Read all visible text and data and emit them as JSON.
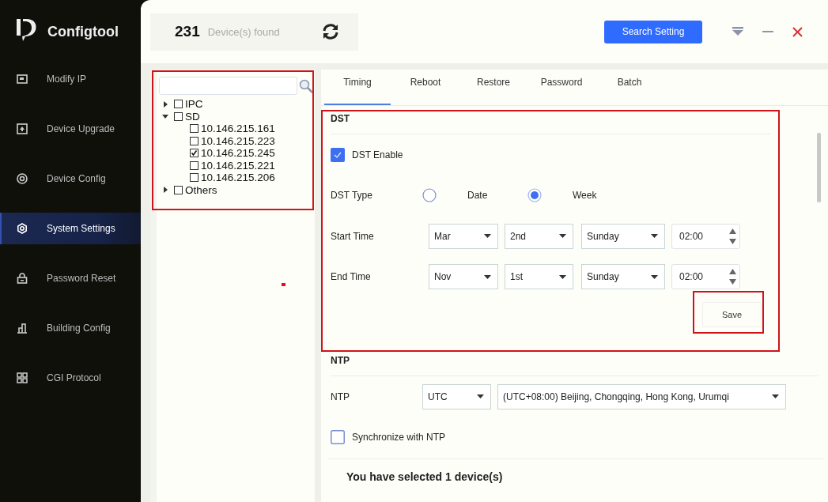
{
  "app": {
    "name": "Configtool"
  },
  "sidebar": {
    "items": [
      {
        "label": "Modify IP",
        "kind": "ip",
        "selected": false
      },
      {
        "label": "Device Upgrade",
        "kind": "upgrade",
        "selected": false
      },
      {
        "label": "Device Config",
        "kind": "config",
        "selected": false
      },
      {
        "label": "System Settings",
        "kind": "settings",
        "selected": true
      },
      {
        "label": "Password Reset",
        "kind": "lock",
        "selected": false
      },
      {
        "label": "Building Config",
        "kind": "building",
        "selected": false
      },
      {
        "label": "CGI Protocol",
        "kind": "grid",
        "selected": false
      }
    ]
  },
  "header": {
    "count": "231",
    "count_label": "Device(s) found",
    "search_button": "Search Setting"
  },
  "device_tree": {
    "highlighted": true,
    "items": [
      {
        "label": "IPC",
        "checked": false,
        "expanded": false
      },
      {
        "label": "SD",
        "checked": false,
        "expanded": true,
        "children": [
          {
            "label": "10.146.215.161",
            "checked": false
          },
          {
            "label": "10.146.215.223",
            "checked": false
          },
          {
            "label": "10.146.215.245",
            "checked": true
          },
          {
            "label": "10.146.215.221",
            "checked": false
          },
          {
            "label": "10.146.215.206",
            "checked": false
          }
        ]
      },
      {
        "label": "Others",
        "checked": false,
        "expanded": false
      }
    ]
  },
  "tabs": [
    {
      "label": "Timing",
      "selected": true
    },
    {
      "label": "Reboot",
      "selected": false
    },
    {
      "label": "Restore",
      "selected": false
    },
    {
      "label": "Password",
      "selected": false
    },
    {
      "label": "Batch",
      "selected": false
    }
  ],
  "dst": {
    "title": "DST",
    "highlighted": true,
    "enable": {
      "label": "DST Enable",
      "checked": true
    },
    "type": {
      "label": "DST Type",
      "options": [
        {
          "label": "Date",
          "selected": false
        },
        {
          "label": "Week",
          "selected": true
        }
      ]
    },
    "rows": [
      {
        "label": "Start Time",
        "month": "Mar",
        "week": "2nd",
        "day": "Sunday",
        "time": "02:00"
      },
      {
        "label": "End Time",
        "month": "Nov",
        "week": "1st",
        "day": "Sunday",
        "time": "02:00"
      }
    ],
    "save": {
      "label": "Save",
      "highlighted": true
    }
  },
  "ntp": {
    "title": "NTP",
    "label": "NTP",
    "server": "UTC",
    "timezone": "(UTC+08:00) Beijing, Chongqing, Hong Kong, Urumqi",
    "sync": {
      "label": "Synchronize with NTP",
      "checked": false
    }
  },
  "footer": {
    "text": "You have selected 1 device(s)"
  }
}
